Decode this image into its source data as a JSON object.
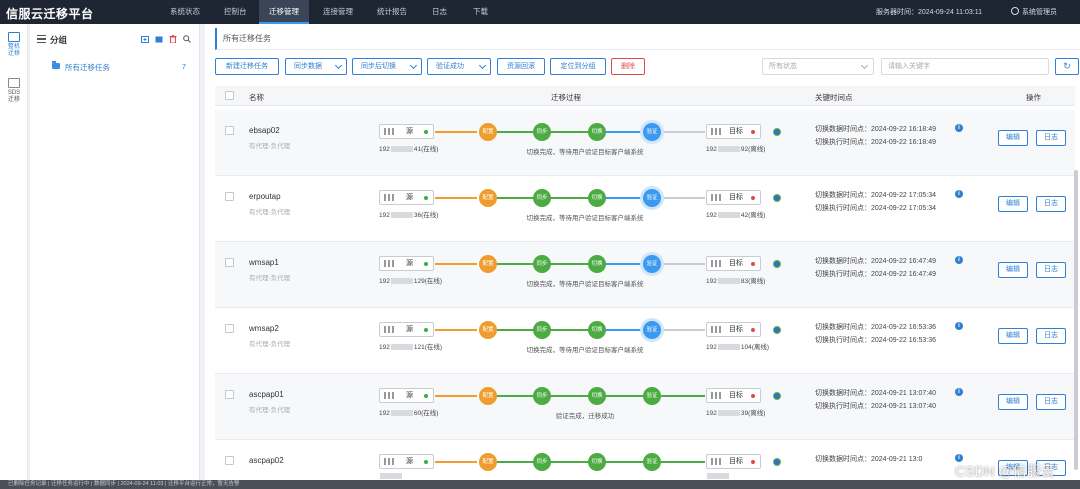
{
  "app": {
    "title": "信服云迁移平台"
  },
  "topnav": {
    "items": [
      "系统状态",
      "控制台",
      "迁移管理",
      "连接管理",
      "统计报告",
      "日志",
      "下载"
    ],
    "active_index": 2,
    "server_time": "服务器时间：2024-09-24 11:03:11",
    "user": "系统管理员"
  },
  "sidenav": {
    "items": [
      {
        "label": "整机\n迁移",
        "icon": "server-migrate-icon",
        "active": true
      },
      {
        "label": "SDS\n迁移",
        "icon": "storage-migrate-icon",
        "active": false
      }
    ]
  },
  "groups": {
    "title": "分组",
    "folder": {
      "label": "所有迁移任务",
      "count": "7"
    }
  },
  "main": {
    "breadcrumb": "所有迁移任务",
    "toolbar": {
      "new_task": "新建迁移任务",
      "sync_data": "同步数据",
      "sync_switch": "同步后切换",
      "verify_success": "验证成功",
      "reclaim": "资源回滚",
      "locate_group": "定位到分组",
      "delete": "删除",
      "status_filter": "所有状态",
      "search_placeholder": "请输入关键字",
      "refresh": "↻"
    },
    "table": {
      "headers": {
        "name": "名称",
        "process": "迁移过程",
        "time": "关键时间点",
        "action": "操作"
      },
      "step_labels": {
        "deploy": "配置",
        "sync": "同步",
        "switch": "切换",
        "verify": "验证"
      },
      "source_label": "源",
      "target_label": "目标",
      "edit_label": "编辑",
      "log_label": "日志",
      "rows": [
        {
          "name": "ebsap02",
          "sub": "有代理-负代理",
          "src_ip_a": "192",
          "src_ip_b": "41(在线)",
          "dst_ip_a": "192",
          "dst_ip_b": "92(离线)",
          "status": "切换完成，等待用户验证目标客户端系统",
          "verified": false,
          "t1": "切换数据时间点：2024-09-22 16:18:49",
          "t2": "切换执行时间点：2024-09-22 16:18:49"
        },
        {
          "name": "erpoutap",
          "sub": "有代理-负代理",
          "src_ip_a": "192",
          "src_ip_b": "36(在线)",
          "dst_ip_a": "192",
          "dst_ip_b": "42(离线)",
          "status": "切换完成，等待用户验证目标客户端系统",
          "verified": false,
          "t1": "切换数据时间点：2024-09-22 17:05:34",
          "t2": "切换执行时间点：2024-09-22 17:05:34"
        },
        {
          "name": "wmsap1",
          "sub": "有代理-负代理",
          "src_ip_a": "192",
          "src_ip_b": "129(在线)",
          "dst_ip_a": "192",
          "dst_ip_b": "83(离线)",
          "status": "切换完成，等待用户验证目标客户端系统",
          "verified": false,
          "t1": "切换数据时间点：2024-09-22 16:47:49",
          "t2": "切换执行时间点：2024-09-22 16:47:49"
        },
        {
          "name": "wmsap2",
          "sub": "有代理-负代理",
          "src_ip_a": "192",
          "src_ip_b": "121(在线)",
          "dst_ip_a": "192",
          "dst_ip_b": "104(离线)",
          "status": "切换完成，等待用户验证目标客户端系统",
          "verified": false,
          "t1": "切换数据时间点：2024-09-22 16:53:36",
          "t2": "切换执行时间点：2024-09-22 16:53:36"
        },
        {
          "name": "ascpap01",
          "sub": "有代理-负代理",
          "src_ip_a": "192",
          "src_ip_b": "60(在线)",
          "dst_ip_a": "192",
          "dst_ip_b": "39(离线)",
          "status": "验证完成，迁移成功",
          "verified": true,
          "t1": "切换数据时间点：2024-09-21 13:07:40",
          "t2": "切换执行时间点：2024-09-21 13:07:40"
        },
        {
          "name": "ascpap02",
          "sub": "",
          "src_ip_a": "",
          "src_ip_b": "",
          "dst_ip_a": "",
          "dst_ip_b": "",
          "status": "",
          "verified": true,
          "t1": "切换数据时间点：2024-09-21 13:0",
          "t2": ""
        }
      ]
    }
  },
  "statusbar": "已删除任务记录 | 迁移任务运行中 | 数据同步 | 2024-09-24 11:03 | 迁移平台运行正常，暂无告警",
  "watermark": "CSDN @信服云",
  "colors": {
    "accent": "#2f7fd3",
    "deploy": "#ef9d2f",
    "done": "#4cab43",
    "current": "#3b9af0",
    "danger": "#e04b4b"
  }
}
